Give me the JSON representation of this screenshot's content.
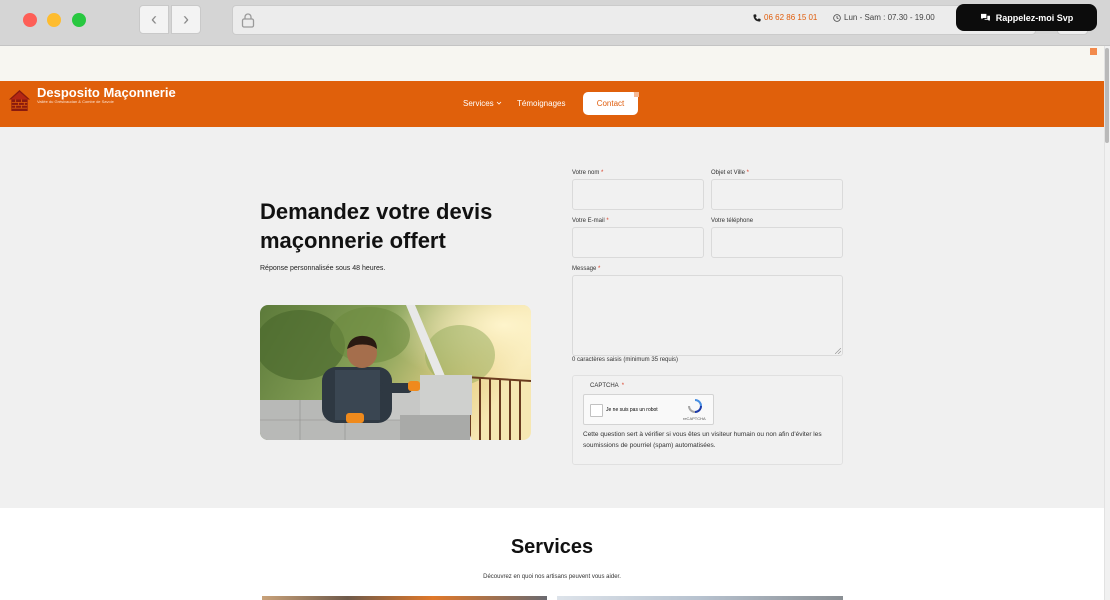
{
  "topbar": {
    "phone": "06 62 86 15 01",
    "hours": "Lun - Sam : 07.30 - 19.00",
    "callback_label": "Rappelez-moi Svp"
  },
  "header": {
    "brand": "Desposito Maçonnerie",
    "tagline": "Vallée du Grésivaudan & Combe de Savoie",
    "nav": {
      "services": "Services",
      "testimonials": "Témoignages",
      "contact": "Contact"
    }
  },
  "hero": {
    "title": "Demandez votre devis maçonnerie offert",
    "subtitle": "Réponse personnalisée sous 48 heures."
  },
  "form": {
    "name_label": "Votre nom",
    "subject_label": "Objet et Ville",
    "email_label": "Votre E-mail",
    "phone_label": "Votre téléphone",
    "message_label": "Message",
    "required_mark": "*",
    "counter": "0 caractères saisis (minimum 35 requis)",
    "captcha_label": "CAPTCHA",
    "recaptcha_text": "Je ne suis pas un robot",
    "recaptcha_brand": "reCAPTCHA",
    "captcha_note": "Cette question sert à vérifier si vous êtes un visiteur humain ou non afin d'éviter les soumissions de pourriel (spam) automatisées."
  },
  "services": {
    "title": "Services",
    "subtitle": "Découvrez en quoi nos artisans peuvent vous aider."
  },
  "colors": {
    "accent": "#e0600b",
    "dark": "#0c0c0c",
    "background": "#f0f0f0"
  },
  "icons": [
    "lock-icon",
    "sidebar-menu-icon",
    "phone-icon",
    "clock-icon",
    "chat-icon",
    "house-logo-icon",
    "chevron-down-icon",
    "recaptcha-logo-icon"
  ]
}
